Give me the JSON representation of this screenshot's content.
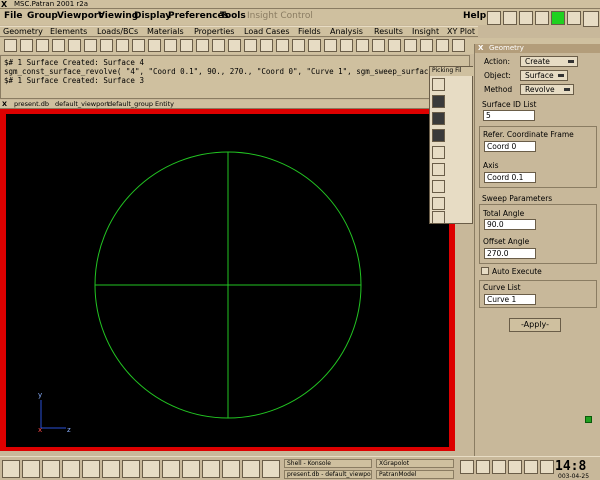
{
  "window": {
    "title": "MSC.Patran 2001 r2a"
  },
  "menubar": {
    "items": [
      "File",
      "Group",
      "Viewport",
      "Viewing",
      "Display",
      "Preferences",
      "Tools",
      "Insight Control"
    ],
    "help": "Help"
  },
  "appmenu": {
    "items": [
      "Geometry",
      "Elements",
      "Loads/BCs",
      "Materials",
      "Properties",
      "Load Cases",
      "Fields",
      "Analysis",
      "Results",
      "Insight",
      "XY Plot"
    ]
  },
  "command_history": [
    "$# 1 Surface Created: Surface 4",
    "sgm_const_surface_revolve( \"4\", \"Coord 0.1\", 90., 270., \"Coord 0\", \"Curve 1\", sgm_sweep_surface_r_created_ids )",
    "$# 1 Surface Created: Surface 3"
  ],
  "viewport": {
    "title_parts": [
      "present.db",
      "default_viewport",
      "default_group",
      "Entity"
    ],
    "axes": {
      "y": "y",
      "x": "x",
      "z": "z"
    }
  },
  "picking": {
    "title": "Picking Fil"
  },
  "geometry_panel": {
    "title": "Geometry",
    "action_label": "Action:",
    "action_value": "Create",
    "object_label": "Object:",
    "object_value": "Surface",
    "method_label": "Method",
    "method_value": "Revolve",
    "surface_id_label": "Surface ID List",
    "surface_id_value": "5",
    "ref_frame_label": "Refer. Coordinate Frame",
    "ref_frame_value": "Coord 0",
    "axis_label": "Axis",
    "axis_value": "Coord 0.1",
    "sweep_label": "Sweep Parameters",
    "total_angle_label": "Total Angle",
    "total_angle_value": "90.0",
    "offset_angle_label": "Offset Angle",
    "offset_angle_value": "270.0",
    "auto_execute_label": "Auto Execute",
    "curve_list_label": "Curve List",
    "curve_list_value": "Curve 1",
    "apply_label": "-Apply-"
  },
  "taskbar": {
    "tasks": [
      "Shell - Konsole",
      "XGrapolot",
      "present.db - default_viewport - ...",
      "PatranModel"
    ],
    "clock": "14:8",
    "date": "003-04-25"
  },
  "colors": {
    "viewport_border": "#dd0000",
    "geometry_green": "#22c422",
    "status_green": "#1fd11f"
  }
}
